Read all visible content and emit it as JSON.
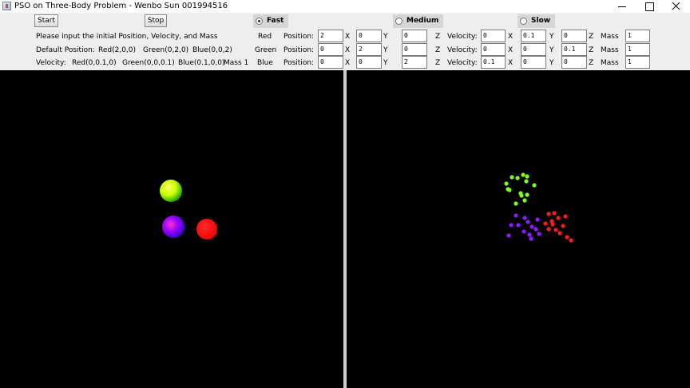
{
  "window": {
    "title": "PSO on Three-Body Problem - Wenbo Sun 001994516"
  },
  "controls": {
    "start_label": "Start",
    "stop_label": "Stop",
    "speeds": [
      {
        "label": "Fast",
        "selected": true
      },
      {
        "label": "Medium",
        "selected": false
      },
      {
        "label": "Slow",
        "selected": false
      }
    ],
    "info_line": "Please input the initial Position, Velocity, and Mass",
    "default_position_label": "Default Position:",
    "default_positions": [
      "Red(2,0,0)",
      "Green(0,2,0)",
      "Blue(0,0,2)"
    ],
    "velocity_label": "Velocity:",
    "default_velocities": [
      "Red(0,0.1,0)",
      "Green(0,0,0.1)",
      "Blue(0.1,0,0)"
    ],
    "default_mass": "Mass 1",
    "position_label": "Position:",
    "velocity_field_label": "Velocity:",
    "mass_label": "Mass",
    "axis_labels": [
      "X",
      "Y",
      "Z"
    ],
    "bodies": [
      {
        "name": "Red",
        "position": [
          "2",
          "0",
          "0"
        ],
        "velocity": [
          "0",
          "0.1",
          "0"
        ],
        "mass": "1"
      },
      {
        "name": "Green",
        "position": [
          "0",
          "2",
          "0"
        ],
        "velocity": [
          "0",
          "0",
          "0.1"
        ],
        "mass": "1"
      },
      {
        "name": "Blue",
        "position": [
          "0",
          "0",
          "2"
        ],
        "velocity": [
          "0.1",
          "0",
          "0"
        ],
        "mass": "1"
      }
    ]
  },
  "colors": {
    "red_body": "#ff0000",
    "green_body": "#ccff00",
    "blue_body": "#8a00ff",
    "red_particle": "#ff1a1a",
    "green_particle": "#7cff1a",
    "purple_particle": "#8c1aff"
  }
}
